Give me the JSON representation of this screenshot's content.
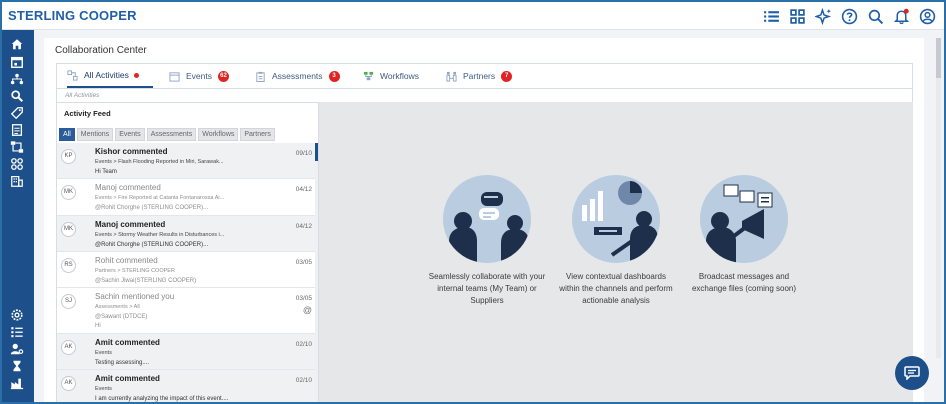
{
  "app": {
    "brand": "STERLING COOPER"
  },
  "topbar": {
    "icons": [
      "list-icon",
      "grid-icon",
      "sparkle-icon",
      "help-icon",
      "search-icon",
      "bell-icon",
      "account-icon"
    ]
  },
  "sidenav": {
    "top_icons": [
      "home-icon",
      "calendar-icon",
      "org-chart-icon",
      "search-icon",
      "tag-icon",
      "document-icon",
      "workflow-icon",
      "apps-icon",
      "building-icon"
    ],
    "bottom_icons": [
      "settings-icon",
      "checklist-icon",
      "user-settings-icon",
      "hourglass-icon",
      "factory-icon"
    ]
  },
  "page": {
    "title": "Collaboration Center"
  },
  "tabs": [
    {
      "label": "All Activities",
      "icon": "activity-icon",
      "badge": "",
      "dot": true
    },
    {
      "label": "Events",
      "icon": "calendar-icon",
      "badge": "62"
    },
    {
      "label": "Assessments",
      "icon": "clipboard-icon",
      "badge": "3"
    },
    {
      "label": "Workflows",
      "icon": "workflow-icon",
      "badge": ""
    },
    {
      "label": "Partners",
      "icon": "partners-icon",
      "badge": "7"
    }
  ],
  "breadcrumb": "All Activities",
  "feed": {
    "title": "Activity Feed",
    "filters": [
      "All",
      "Mentions",
      "Events",
      "Assessments",
      "Workflows",
      "Partners"
    ],
    "items": [
      {
        "initials": "KP",
        "title": "Kishor commented",
        "line2": "Events > Flash Flooding Reported in Miri, Sarawak...",
        "line3": "Hi Team",
        "date": "09/10",
        "unread": true
      },
      {
        "initials": "MK",
        "title": "Manoj commented",
        "line2": "Events > Fire Reported at Catania Fontanarossa Ai...",
        "line3": "@Rohit Chorghe (STERLING COOPER)...",
        "date": "04/12",
        "unread": false
      },
      {
        "initials": "MK",
        "title": "Manoj commented",
        "line2": "Events > Stormy Weather Results in Disturbances i...",
        "line3": "@Rohit Chorghe (STERLING COOPER)...",
        "date": "04/12",
        "unread": true
      },
      {
        "initials": "RS",
        "title": "Rohit commented",
        "line2": "Partners > STERLING COOPER",
        "line3": "@Sachin Jiwai(STERLING COOPER)",
        "date": "03/05",
        "unread": false
      },
      {
        "initials": "SJ",
        "title": "Sachin mentioned you",
        "line2": "Assessments > All",
        "line3": "@Sawant (DTDCE)",
        "line4": "Hi",
        "date": "03/05",
        "mention": "@",
        "unread": false
      },
      {
        "initials": "AK",
        "title": "Amit commented",
        "line2": "Events",
        "line3": "Testing assessing....",
        "date": "02/10",
        "unread": true
      },
      {
        "initials": "AK",
        "title": "Amit commented",
        "line2": "Events",
        "line3": "I am currently analyzing the impact of this event....",
        "date": "02/10",
        "unread": true
      }
    ]
  },
  "features": [
    {
      "caption": "Seamlessly collaborate with your internal teams (My Team) or Suppliers"
    },
    {
      "caption": "View contextual dashboards within the channels and perform actionable analysis"
    },
    {
      "caption": "Broadcast messages and exchange files (coming soon)"
    }
  ],
  "colors": {
    "brand": "#1f5fa6",
    "nav": "#1d4f8a",
    "badge": "#e02424"
  }
}
